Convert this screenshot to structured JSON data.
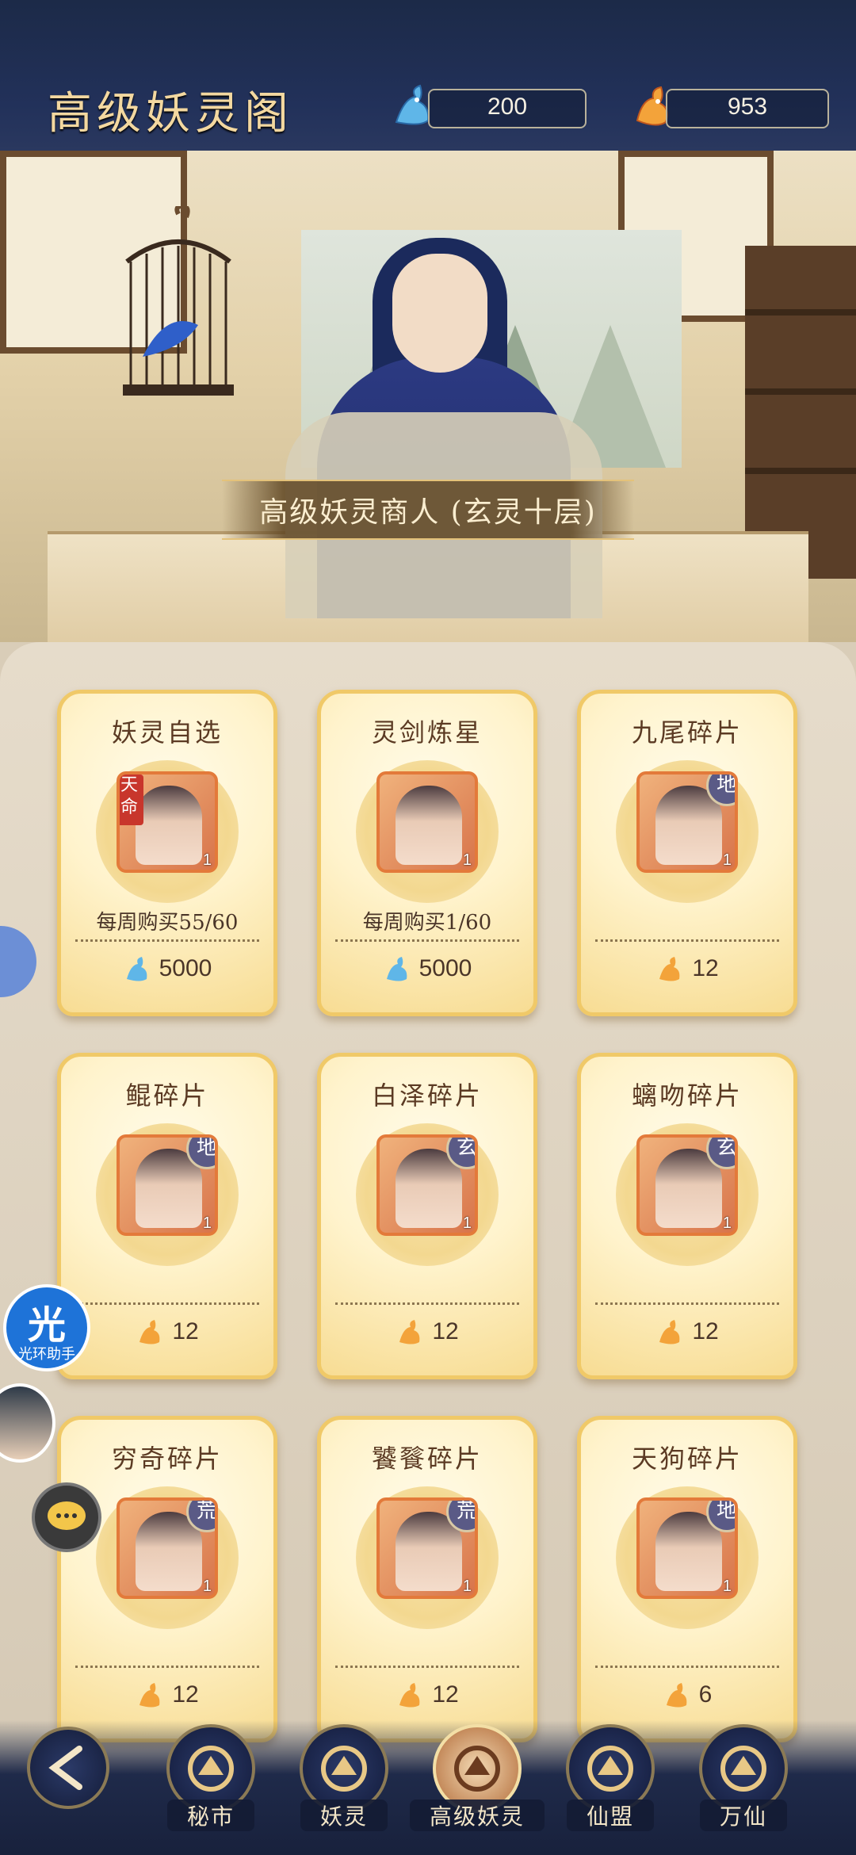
{
  "header": {
    "title": "高级妖灵阁",
    "currency_blue": {
      "icon": "blue-fox-spirit-icon",
      "value": "200"
    },
    "currency_gold": {
      "icon": "orange-fire-spirit-icon",
      "value": "953"
    }
  },
  "scene": {
    "merchant_banner": "高级妖灵商人 (玄灵十层)"
  },
  "shop": {
    "items": [
      {
        "name": "妖灵自选",
        "qty": "1",
        "badge": "天命",
        "badge_type": "red",
        "limit": "每周购买55/60",
        "price": "5000",
        "currency_icon": "blue-fox-spirit-icon"
      },
      {
        "name": "灵剑炼星",
        "qty": "1",
        "badge": "",
        "badge_type": "none",
        "limit": "每周购买1/60",
        "price": "5000",
        "currency_icon": "blue-fox-spirit-icon"
      },
      {
        "name": "九尾碎片",
        "qty": "1",
        "badge": "地",
        "badge_type": "circle",
        "limit": "",
        "price": "12",
        "currency_icon": "orange-fire-spirit-icon"
      },
      {
        "name": "鲲碎片",
        "qty": "1",
        "badge": "地",
        "badge_type": "circle",
        "limit": "",
        "price": "12",
        "currency_icon": "orange-fire-spirit-icon"
      },
      {
        "name": "白泽碎片",
        "qty": "1",
        "badge": "玄",
        "badge_type": "circle",
        "limit": "",
        "price": "12",
        "currency_icon": "orange-fire-spirit-icon"
      },
      {
        "name": "螭吻碎片",
        "qty": "1",
        "badge": "玄",
        "badge_type": "circle",
        "limit": "",
        "price": "12",
        "currency_icon": "orange-fire-spirit-icon"
      },
      {
        "name": "穷奇碎片",
        "qty": "1",
        "badge": "荒",
        "badge_type": "circle",
        "limit": "",
        "price": "12",
        "currency_icon": "orange-fire-spirit-icon"
      },
      {
        "name": "饕餮碎片",
        "qty": "1",
        "badge": "荒",
        "badge_type": "circle",
        "limit": "",
        "price": "12",
        "currency_icon": "orange-fire-spirit-icon"
      },
      {
        "name": "天狗碎片",
        "qty": "1",
        "badge": "地",
        "badge_type": "circle",
        "limit": "",
        "price": "6",
        "currency_icon": "orange-fire-spirit-icon"
      }
    ]
  },
  "floating": {
    "assistant_label": "光环助手",
    "assistant_glyph": "光"
  },
  "nav": {
    "back_icon": "back-arrow-icon",
    "tabs": [
      {
        "label": "秘市",
        "icon": "market-gate-icon",
        "active": false
      },
      {
        "label": "妖灵",
        "icon": "fox-spirit-icon",
        "active": false
      },
      {
        "label": "高级妖灵",
        "icon": "dragon-spirit-icon",
        "active": true
      },
      {
        "label": "仙盟",
        "icon": "alliance-gate-icon",
        "active": false
      },
      {
        "label": "万仙",
        "icon": "sword-circle-icon",
        "active": false
      }
    ]
  }
}
